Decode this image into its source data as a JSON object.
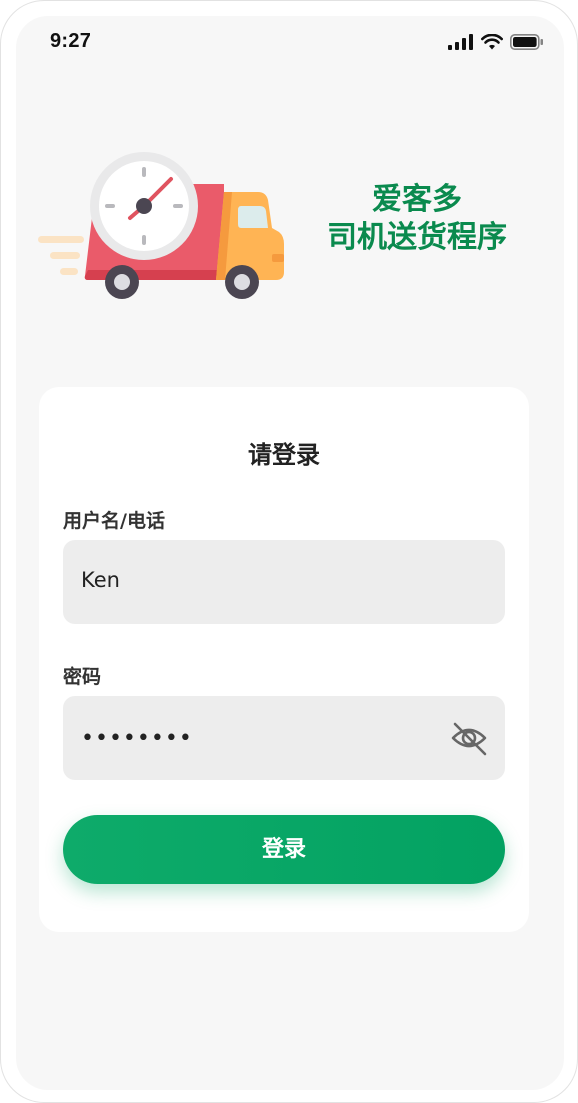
{
  "status_bar": {
    "time": "9:27",
    "icons": [
      "cellular-signal-icon",
      "wifi-icon",
      "battery-icon"
    ]
  },
  "hero": {
    "illustration": "delivery-truck-clock-icon",
    "title_line1": "爱客多",
    "title_line2": "司机送货程序",
    "title_color": "#0a8a4e"
  },
  "login_card": {
    "title": "请登录",
    "username": {
      "label": "用户名/电话",
      "value": "Ken"
    },
    "password": {
      "label": "密码",
      "value_masked": "••••••••",
      "toggle_icon": "eye-slash-icon"
    },
    "submit_label": "登录",
    "accent_color": "#03a262"
  }
}
